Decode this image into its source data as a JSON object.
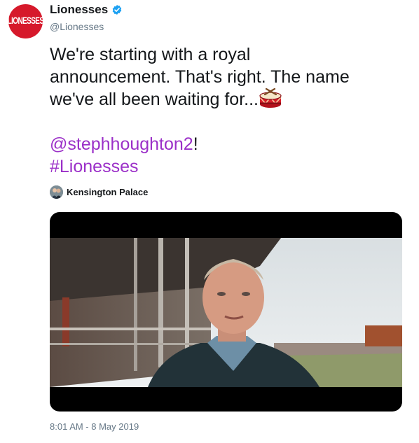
{
  "account": {
    "display_name": "Lionesses",
    "handle": "@Lionesses",
    "verified": true,
    "avatar_text": "LIONESSES",
    "avatar_color": "#d6192b"
  },
  "tweet": {
    "line1": "We're starting with a royal",
    "line2": "announcement. That's right. The name",
    "line3": "we've all been waiting for...",
    "mention": "@stephhoughton2",
    "mention_suffix": "!",
    "hashtag": "#Lionesses",
    "link_color": "#9b30c8"
  },
  "via": {
    "name": "Kensington Palace"
  },
  "media": {
    "type": "video",
    "icon": "video-thumbnail"
  },
  "timestamp": "8:01 AM - 8 May 2019"
}
